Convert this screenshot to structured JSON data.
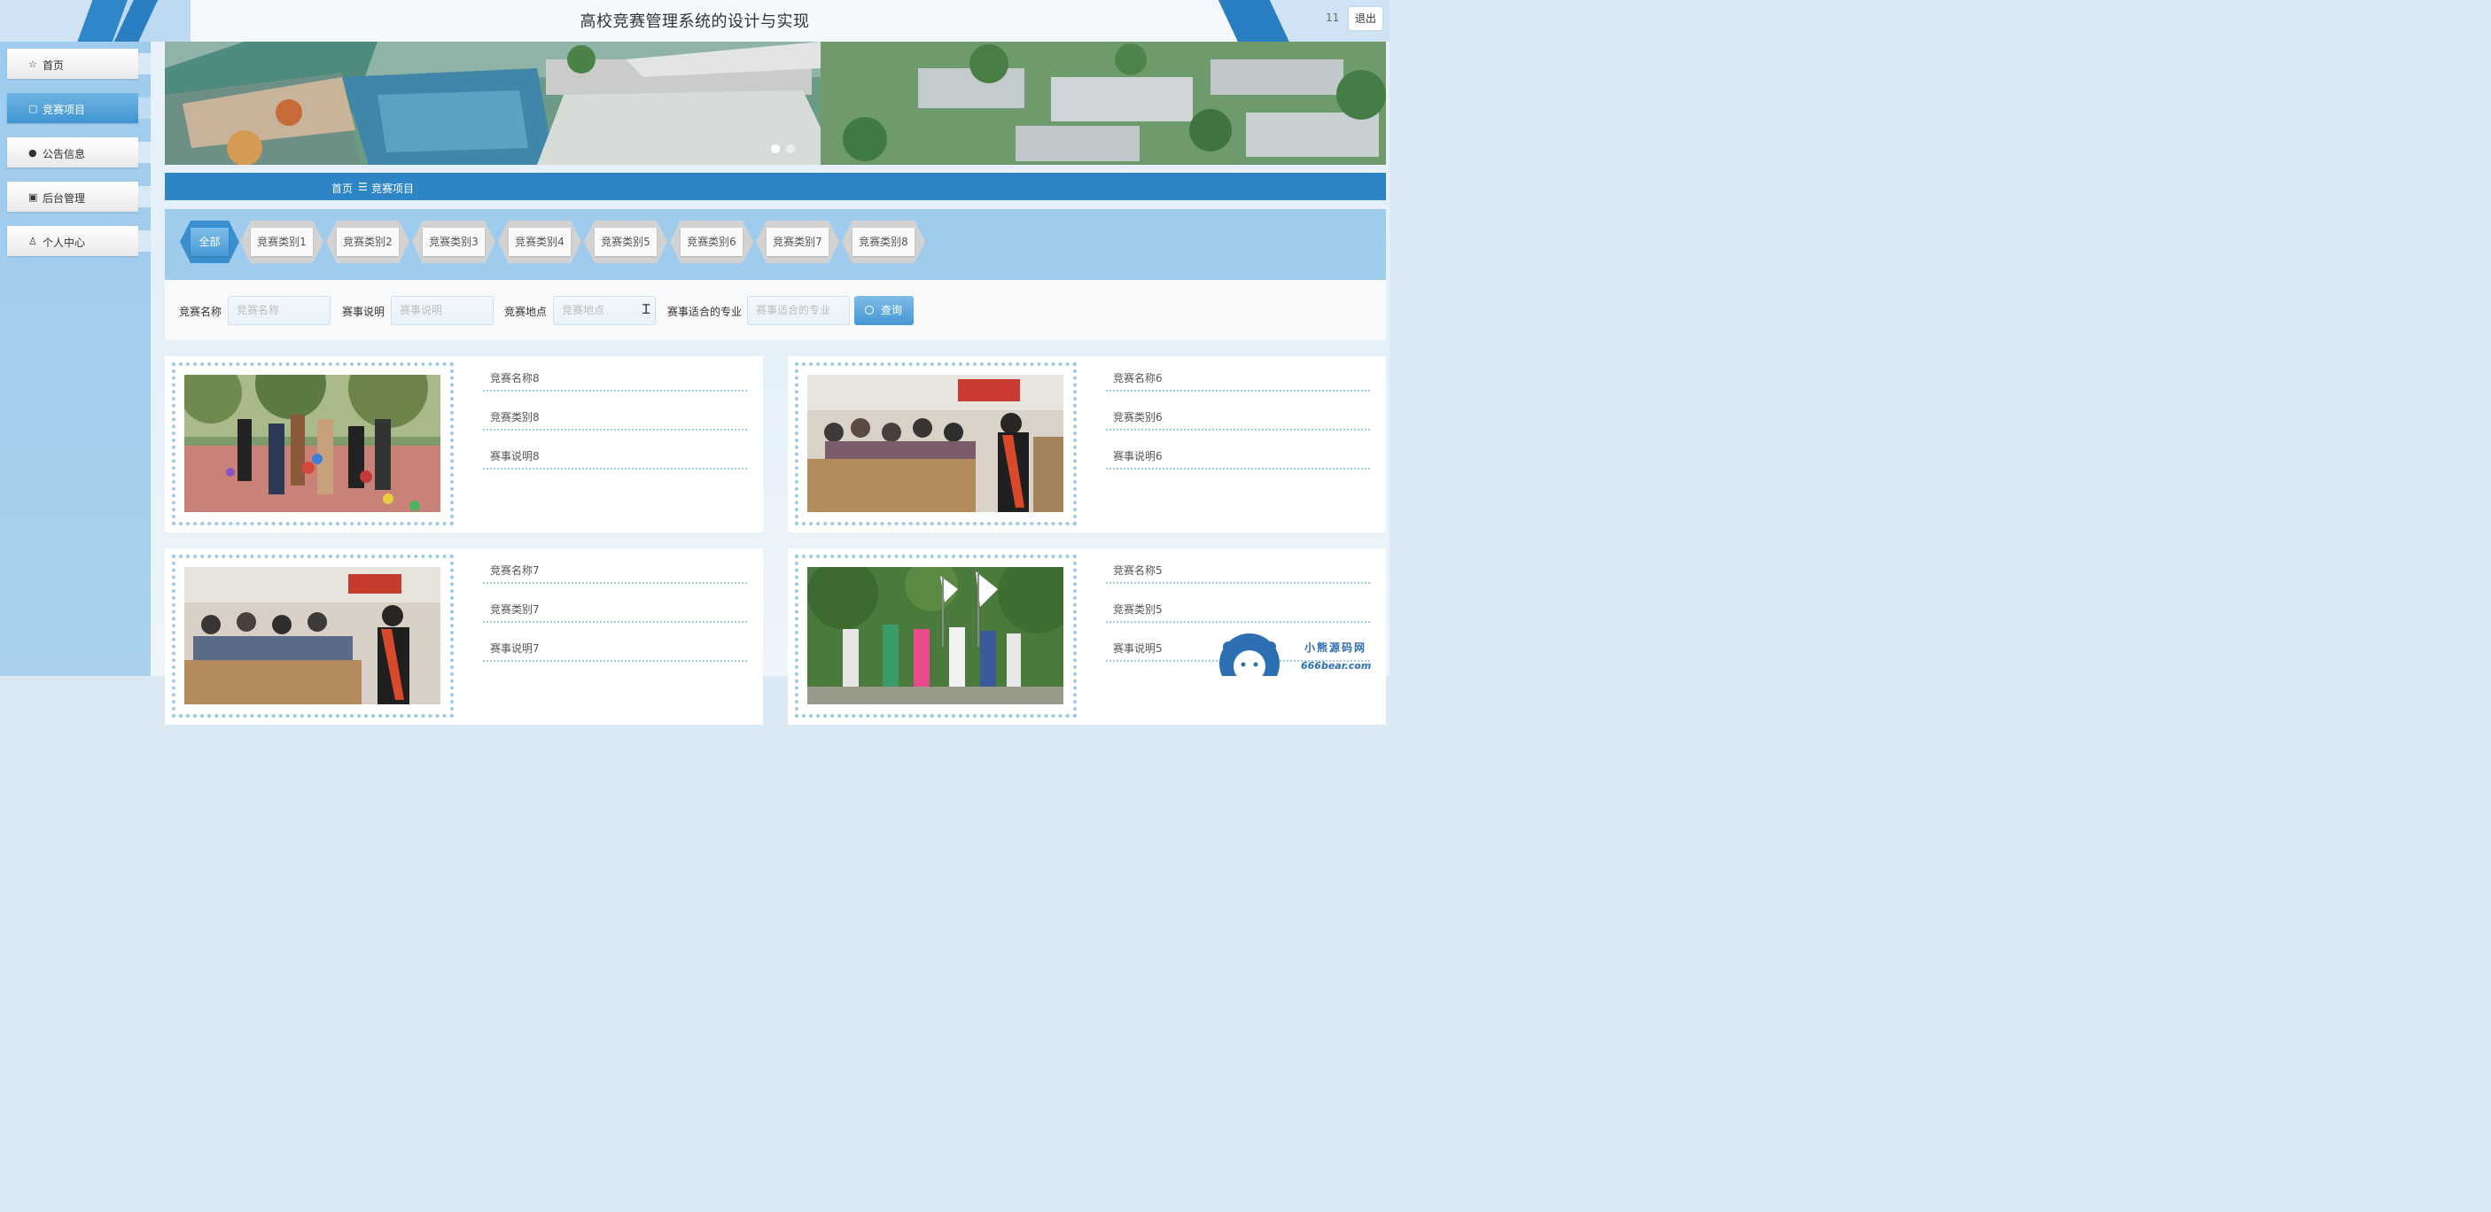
{
  "header": {
    "title": "高校竞赛管理系统的设计与实现",
    "username": "11",
    "logout_label": "退出"
  },
  "sidebar": {
    "items": [
      {
        "label": "首页",
        "icon": "star-icon",
        "glyph": "☆",
        "active": false
      },
      {
        "label": "竞赛项目",
        "icon": "briefcase-icon",
        "glyph": "▢",
        "active": true
      },
      {
        "label": "公告信息",
        "icon": "alert-icon",
        "glyph": "●",
        "active": false
      },
      {
        "label": "后台管理",
        "icon": "package-icon",
        "glyph": "▣",
        "active": false
      },
      {
        "label": "个人中心",
        "icon": "user-icon",
        "glyph": "♙",
        "active": false
      }
    ]
  },
  "breadcrumb": {
    "home": "首页",
    "separator": "☰",
    "current": "竞赛项目"
  },
  "categories": [
    "全部",
    "竞赛类别1",
    "竞赛类别2",
    "竞赛类别3",
    "竞赛类别4",
    "竞赛类别5",
    "竞赛类别6",
    "竞赛类别7",
    "竞赛类别8"
  ],
  "search": {
    "fields": [
      {
        "label": "竞赛名称",
        "placeholder": "竞赛名称"
      },
      {
        "label": "赛事说明",
        "placeholder": "赛事说明"
      },
      {
        "label": "竞赛地点",
        "placeholder": "竞赛地点"
      },
      {
        "label": "赛事适合的专业",
        "placeholder": "赛事适合的专业"
      }
    ],
    "button_label": "查询"
  },
  "cards": [
    {
      "name": "竞赛名称8",
      "category": "竞赛类别8",
      "description": "赛事说明8"
    },
    {
      "name": "竞赛名称6",
      "category": "竞赛类别6",
      "description": "赛事说明6"
    },
    {
      "name": "竞赛名称7",
      "category": "竞赛类别7",
      "description": "赛事说明7"
    },
    {
      "name": "竞赛名称5",
      "category": "竞赛类别5",
      "description": "赛事说明5"
    }
  ],
  "watermark": {
    "name": "小熊源码网",
    "url": "666bear.com"
  },
  "colors": {
    "primary": "#2e85c6",
    "sidebar": "#a4cdee",
    "dots": "#9ccbe9"
  }
}
